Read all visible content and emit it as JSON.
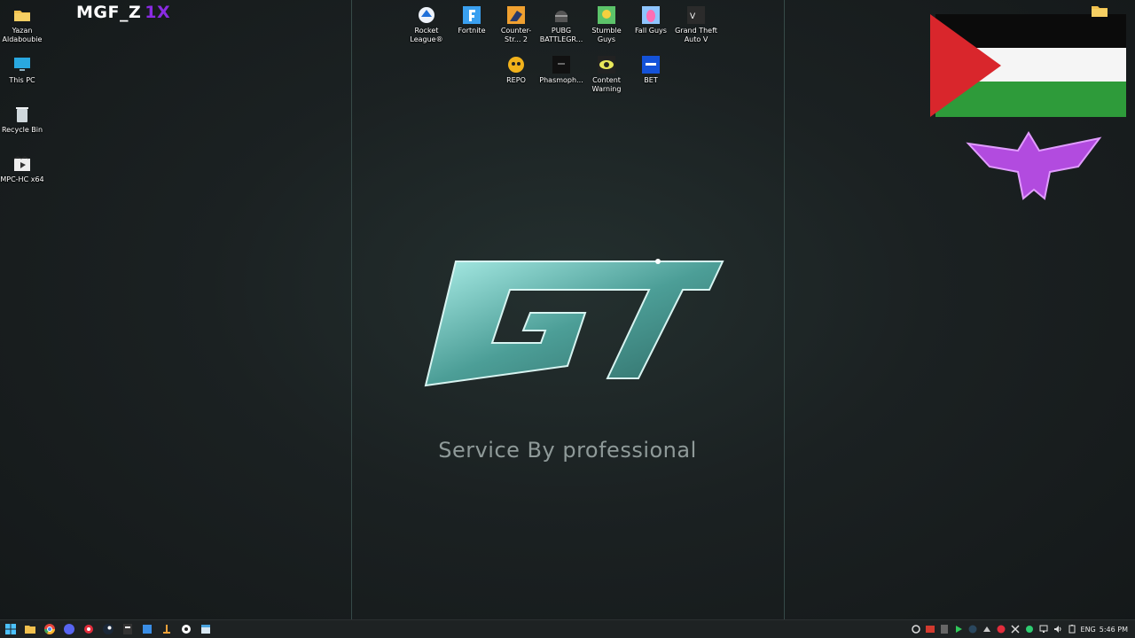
{
  "desktop_left_icons": [
    {
      "label": "Yazan Aldaboubie",
      "icon": "folder-icon"
    },
    {
      "label": "This PC",
      "icon": "monitor-icon"
    },
    {
      "label": "Recycle Bin",
      "icon": "recycle-bin-icon"
    },
    {
      "label": "MPC-HC x64",
      "icon": "media-player-icon"
    }
  ],
  "desktop_top_icons_row1": [
    {
      "label": "Rocket League®",
      "icon": "rocket-league-icon"
    },
    {
      "label": "Fortnite",
      "icon": "fortnite-icon"
    },
    {
      "label": "Counter-Str... 2",
      "icon": "counter-strike-icon"
    },
    {
      "label": "PUBG BATTLEGR...",
      "icon": "pubg-icon"
    },
    {
      "label": "Stumble Guys",
      "icon": "stumble-guys-icon"
    },
    {
      "label": "Fall Guys",
      "icon": "fall-guys-icon"
    },
    {
      "label": "Grand Theft Auto V",
      "icon": "gta-v-icon"
    }
  ],
  "desktop_top_icons_row2": [
    {
      "label": "REPO",
      "icon": "repo-icon"
    },
    {
      "label": "Phasmoph...",
      "icon": "phasmophobia-icon"
    },
    {
      "label": "Content Warning",
      "icon": "content-warning-icon"
    },
    {
      "label": "BET",
      "icon": "bet-icon"
    }
  ],
  "brand": {
    "main": "MGF_Z",
    "accent": "1X"
  },
  "wallpaper": {
    "logo_text": "GT",
    "tagline": "Service By professional"
  },
  "taskbar": {
    "language": "ENG",
    "time": "5:46 PM"
  },
  "colors": {
    "accent_purple": "#8a2be2",
    "logo_teal": "#7fd3cc",
    "taskbar_bg": "#1e2223"
  }
}
